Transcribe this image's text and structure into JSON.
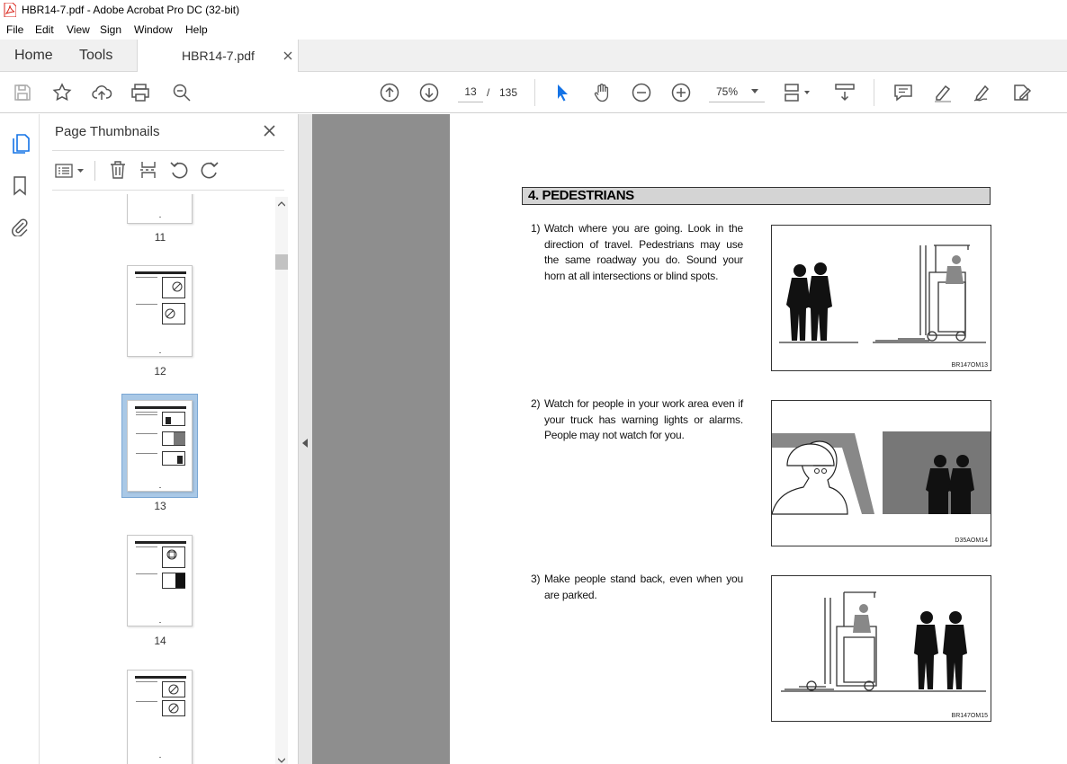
{
  "window": {
    "title": "HBR14-7.pdf - Adobe Acrobat Pro DC (32-bit)"
  },
  "menu": [
    "File",
    "Edit",
    "View",
    "Sign",
    "Window",
    "Help"
  ],
  "tabs": {
    "home": "Home",
    "tools": "Tools",
    "document": "HBR14-7.pdf"
  },
  "toolbar": {
    "current_page": "13",
    "separator": "/",
    "total_pages": "135",
    "zoom": "75%"
  },
  "panel": {
    "title": "Page Thumbnails"
  },
  "thumbnails": [
    {
      "label": "11"
    },
    {
      "label": "12"
    },
    {
      "label": "13",
      "selected": true
    },
    {
      "label": "14"
    },
    {
      "label": ""
    }
  ],
  "document": {
    "section_title": "4. PEDESTRIANS",
    "items": [
      {
        "number": "1)",
        "text": "Watch where you are going.  Look in the direction of travel.  Pedestrians may use the same roadway you do.  Sound your horn at all intersections or blind spots.",
        "caption": "BR147OM13"
      },
      {
        "number": "2)",
        "text": "Watch for people in your work area even if your truck has warning lights or alarms. People may not watch for you.",
        "caption": "D35AOM14"
      },
      {
        "number": "3)",
        "text": "Make people stand back, even when you are parked.",
        "caption": "BR147OM15"
      }
    ]
  },
  "colors": {
    "accent_blue": "#1473e6",
    "viewer_bg": "#8e8e8e",
    "selected_thumb": "#a9c8e6"
  }
}
